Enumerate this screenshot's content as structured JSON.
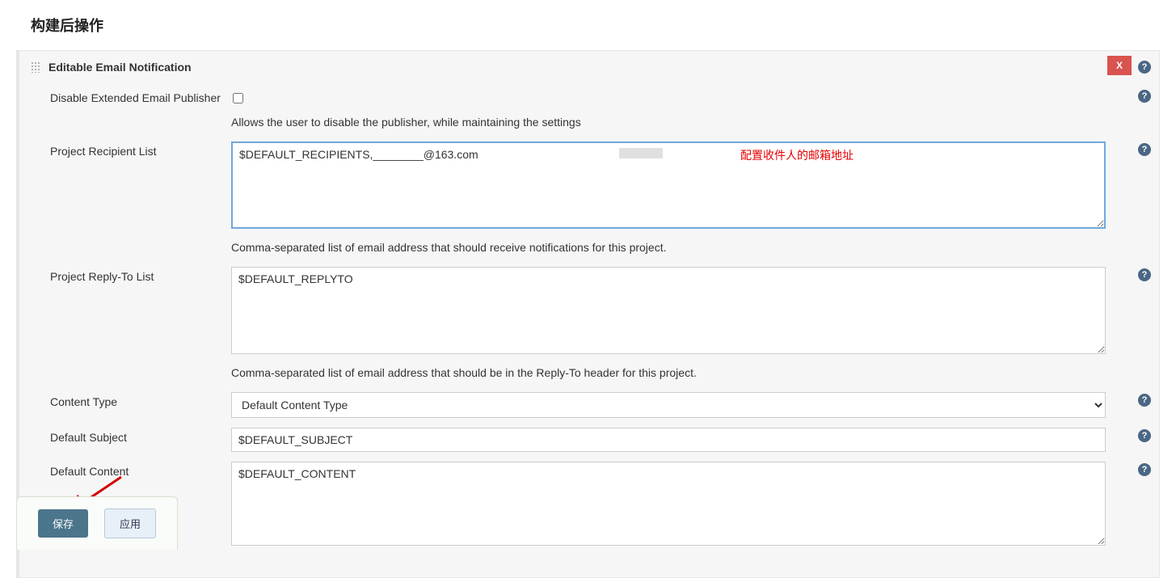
{
  "page_title": "构建后操作",
  "section": {
    "title": "Editable Email Notification",
    "close_label": "X"
  },
  "fields": {
    "disable_publisher": {
      "label": "Disable Extended Email Publisher",
      "help_text": "Allows the user to disable the publisher, while maintaining the settings",
      "checked": false
    },
    "recipient_list": {
      "label": "Project Recipient List",
      "value": "$DEFAULT_RECIPIENTS,________@163.com",
      "annotation": "配置收件人的邮箱地址",
      "help_text": "Comma-separated list of email address that should receive notifications for this project."
    },
    "replyto_list": {
      "label": "Project Reply-To List",
      "value": "$DEFAULT_REPLYTO",
      "help_text": "Comma-separated list of email address that should be in the Reply-To header for this project."
    },
    "content_type": {
      "label": "Content Type",
      "selected": "Default Content Type",
      "options": [
        "Default Content Type"
      ]
    },
    "default_subject": {
      "label": "Default Subject",
      "value": "$DEFAULT_SUBJECT"
    },
    "default_content": {
      "label": "Default Content",
      "value": "$DEFAULT_CONTENT"
    }
  },
  "footer": {
    "save_label": "保存",
    "apply_label": "应用"
  },
  "help_icon_char": "?"
}
